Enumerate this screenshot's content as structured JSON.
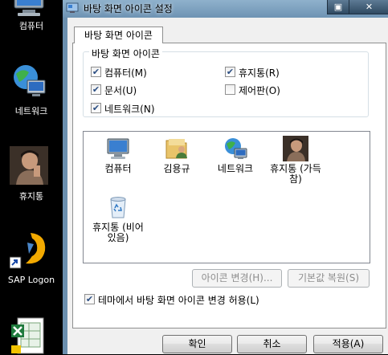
{
  "desktop": {
    "icons": [
      {
        "label": "컴퓨터",
        "icon": "computer-icon"
      },
      {
        "label": "네트워크",
        "icon": "network-icon"
      },
      {
        "label": "휴지통",
        "icon": "recycle-bin-photo-icon"
      },
      {
        "label": "SAP Logon",
        "icon": "sap-logon-icon"
      },
      {
        "label": "",
        "icon": "excel-file-icon"
      }
    ]
  },
  "window": {
    "title": "바탕 화면 아이콘 설정",
    "title_buttons": [
      "▣",
      "✕"
    ]
  },
  "tab": {
    "label": "바탕 화면 아이콘"
  },
  "group": {
    "title": "바탕 화면 아이콘",
    "checkboxes": [
      {
        "label": "컴퓨터(M)",
        "checked": true
      },
      {
        "label": "휴지통(R)",
        "checked": true
      },
      {
        "label": "문서(U)",
        "checked": true
      },
      {
        "label": "제어판(O)",
        "checked": false
      },
      {
        "label": "네트워크(N)",
        "checked": true
      }
    ]
  },
  "icon_list": [
    {
      "label": "컴퓨터",
      "icon": "computer-icon"
    },
    {
      "label": "김용규",
      "icon": "user-folder-icon"
    },
    {
      "label": "네트워크",
      "icon": "network-icon"
    },
    {
      "label": "휴지통 (가득 참)",
      "icon": "recycle-bin-full-icon"
    },
    {
      "label": "휴지통 (비어 있음)",
      "icon": "recycle-bin-empty-icon"
    }
  ],
  "buttons": {
    "change_icon": "아이콘 변경(H)...",
    "restore_default": "기본값 복원(S)"
  },
  "allow_themes": {
    "label": "테마에서 바탕 화면 아이콘 변경 허용(L)",
    "checked": true
  },
  "footer": {
    "ok": "확인",
    "cancel": "취소",
    "apply": "적용(A)"
  },
  "check_mark": "✔",
  "colors": {
    "title_bar": "#7fa3c2",
    "selection": "#2a4d82"
  }
}
